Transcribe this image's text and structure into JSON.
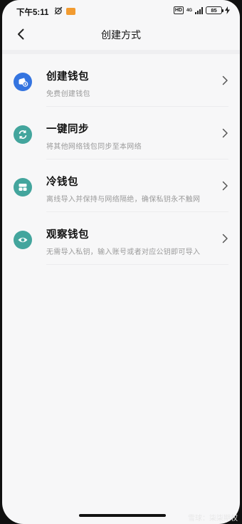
{
  "status_bar": {
    "time": "下午5:11",
    "hd_label": "HD",
    "network_label": "4G",
    "battery_level": "85",
    "icons": [
      "alarm-icon",
      "app-notification-icon",
      "signal-icon",
      "battery-icon",
      "charging-icon"
    ]
  },
  "nav": {
    "title": "创建方式",
    "back_icon": "chevron-left-icon"
  },
  "options": [
    {
      "title": "创建钱包",
      "desc": "免费创建钱包",
      "icon": "wallet-plus-icon",
      "color": "#3474e0"
    },
    {
      "title": "一键同步",
      "desc": "将其他网络钱包同步至本网络",
      "icon": "sync-icon",
      "color": "#43a59d"
    },
    {
      "title": "冷钱包",
      "desc": "离线导入并保持与网络隔绝，确保私钥永不触网",
      "icon": "cold-wallet-icon",
      "color": "#43a59d"
    },
    {
      "title": "观察钱包",
      "desc": "无需导入私钥，输入账号或者对应公钥即可导入",
      "icon": "eye-icon",
      "color": "#43a59d"
    }
  ],
  "watermark": "雪球：柒柒期权"
}
